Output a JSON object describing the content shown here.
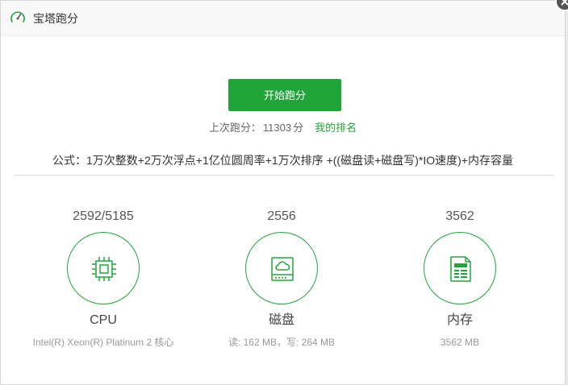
{
  "colors": {
    "accent": "#20a53a",
    "close_button": "#555555"
  },
  "dialog": {
    "title": "宝塔跑分",
    "title_icon": "speedometer-icon",
    "close_icon": "close-icon"
  },
  "benchmark": {
    "start_label": "开始跑分",
    "last_score_label": "上次跑分：",
    "last_score_value": "11303",
    "last_score_unit": "分",
    "rank_link": "我的排名",
    "formula": "公式：1万次整数+2万次浮点+1亿位圆周率+1万次排序 +((磁盘读+磁盘写)*IO速度)+内存容量"
  },
  "items": [
    {
      "score": "2592/5185",
      "name": "CPU",
      "detail": "Intel(R) Xeon(R) Platinum 2 核心",
      "icon": "cpu-icon"
    },
    {
      "score": "2556",
      "name": "磁盘",
      "detail": "读: 162 MB，写: 264 MB",
      "icon": "disk-cloud-icon"
    },
    {
      "score": "3562",
      "name": "内存",
      "detail": "3562 MB",
      "icon": "memory-document-icon"
    }
  ]
}
